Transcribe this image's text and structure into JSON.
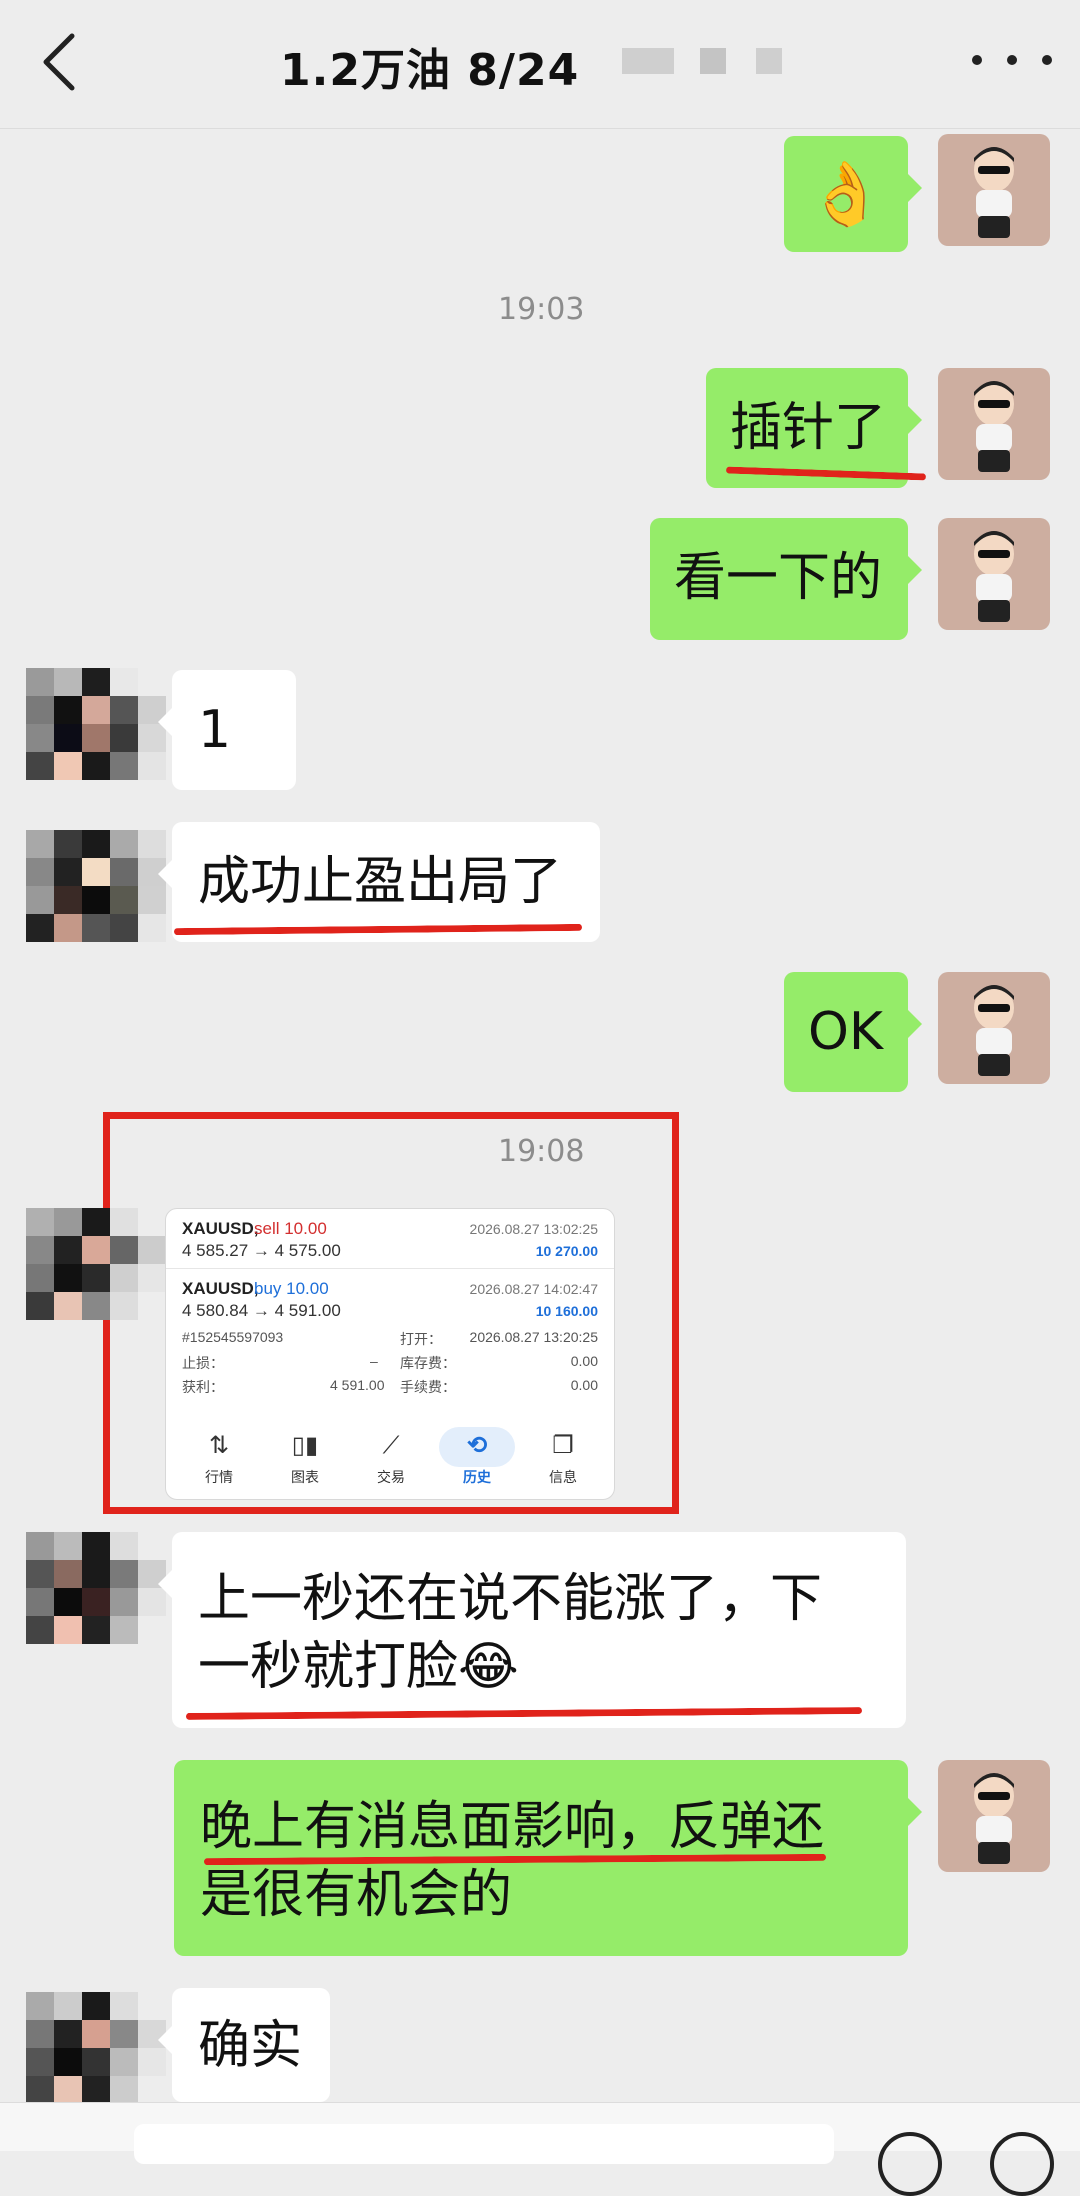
{
  "header": {
    "title": "1.2万油  8/24",
    "back_icon": "chevron-left-icon",
    "more_icon": "more-dots-icon"
  },
  "messages": [
    {
      "side": "me",
      "type": "emoji",
      "emoji": "👌"
    },
    {
      "type": "time",
      "text": "19:03"
    },
    {
      "side": "me",
      "text": "插针了",
      "underlined": true
    },
    {
      "side": "me",
      "text": "看一下的"
    },
    {
      "side": "them",
      "text": "1"
    },
    {
      "side": "them",
      "text": "成功止盈出局了",
      "underlined": true
    },
    {
      "side": "me",
      "text": "OK"
    },
    {
      "type": "time",
      "text": "19:08"
    },
    {
      "side": "them",
      "type": "image",
      "highlighted": true
    },
    {
      "side": "them",
      "text_line1": "上一秒还在说不能涨了，下",
      "text_line2": "一秒就打脸😂",
      "underlined": true
    },
    {
      "side": "me",
      "text_line1": "晚上有消息面影响，反弹还",
      "text_line2": "是很有机会的",
      "underlined": true
    },
    {
      "side": "them",
      "text": "确实"
    }
  ],
  "trade_card": {
    "trades": [
      {
        "symbol": "XAUUSD,",
        "action": "sell 10.00",
        "prices": "4 585.27 → 4 575.00",
        "datetime": "2026.08.27 13:02:25",
        "profit": "10 270.00"
      },
      {
        "symbol": "XAUUSD,",
        "action": "buy 10.00",
        "prices": "4 580.84 → 4 591.00",
        "datetime": "2026.08.27 14:02:47",
        "profit": "10 160.00"
      }
    ],
    "details": {
      "order_id": "#152545597093",
      "open_label": "打开：",
      "open_value": "2026.08.27 13:20:25",
      "sl_label": "止损：",
      "sl_value": "–",
      "swap_label": "库存费：",
      "swap_value": "0.00",
      "tp_label": "获利：",
      "tp_value": "4 591.00",
      "fee_label": "手续费：",
      "fee_value": "0.00"
    },
    "nav": [
      {
        "label": "行情",
        "icon": "sort-arrows-icon"
      },
      {
        "label": "图表",
        "icon": "candlestick-icon"
      },
      {
        "label": "交易",
        "icon": "trend-line-icon"
      },
      {
        "label": "历史",
        "icon": "history-clock-icon",
        "active": true
      },
      {
        "label": "信息",
        "icon": "chat-bubbles-icon"
      }
    ]
  },
  "colors": {
    "my_bubble": "#95ec69",
    "their_bubble": "#ffffff",
    "background": "#ededed",
    "annotation_red": "#e0231b",
    "sell_red": "#d32f2f",
    "buy_blue": "#1e6fd9"
  }
}
